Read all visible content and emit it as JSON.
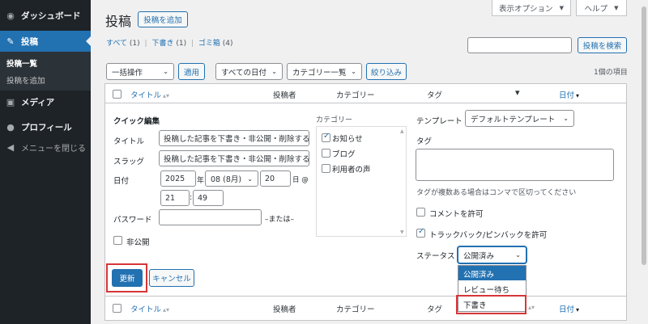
{
  "sidebar": {
    "dashboard": "ダッシュボード",
    "posts": "投稿",
    "posts_list": "投稿一覧",
    "add_post": "投稿を追加",
    "media": "メディア",
    "profile": "プロフィール",
    "collapse": "メニューを閉じる"
  },
  "top": {
    "screen_options": "表示オプション",
    "help": "ヘルプ"
  },
  "header": {
    "title": "投稿",
    "add_new": "投稿を追加"
  },
  "filters": {
    "all": "すべて",
    "all_count": "(1)",
    "draft": "下書き",
    "draft_count": "(1)",
    "trash": "ゴミ箱",
    "trash_count": "(4)",
    "separator": "|"
  },
  "search": {
    "value": "",
    "button": "投稿を検索"
  },
  "bulk": {
    "action": "一括操作",
    "apply": "適用",
    "dates": "すべての日付",
    "category": "カテゴリー一覧",
    "filter": "絞り込み",
    "items": "1個の項目"
  },
  "columns": {
    "title": "タイトル",
    "author": "投稿者",
    "categories": "カテゴリー",
    "tags": "タグ",
    "date": "日付"
  },
  "quick_edit": {
    "heading": "クイック編集",
    "title_label": "タイトル",
    "title_value": "投稿した記事を下書き・非公開・削除する",
    "slug_label": "スラッグ",
    "slug_value": "投稿した記事を下書き・非公開・削除する",
    "date_label": "日付",
    "year": "2025",
    "year_suffix": "年",
    "month": "08 (8月)",
    "day": "20",
    "day_suffix": "日 @",
    "hour": "21",
    "colon": ":",
    "minute": "49",
    "password_label": "パスワード",
    "password_value": "",
    "or_private": "–または–",
    "private_label": "非公開",
    "category_heading": "カテゴリー",
    "cats": [
      "お知らせ",
      "ブログ",
      "利用者の声"
    ],
    "template_label": "テンプレート",
    "template_value": "デフォルトテンプレート",
    "tags_label": "タグ",
    "tags_hint": "タグが複数ある場合はコンマで区切ってください",
    "allow_comments": "コメントを許可",
    "allow_pings": "トラックバック/ピンバックを許可",
    "status_label": "ステータス",
    "status_value": "公開済み",
    "status_options": [
      "公開済み",
      "レビュー待ち",
      "下書き"
    ],
    "update": "更新",
    "cancel": "キャンセル"
  }
}
